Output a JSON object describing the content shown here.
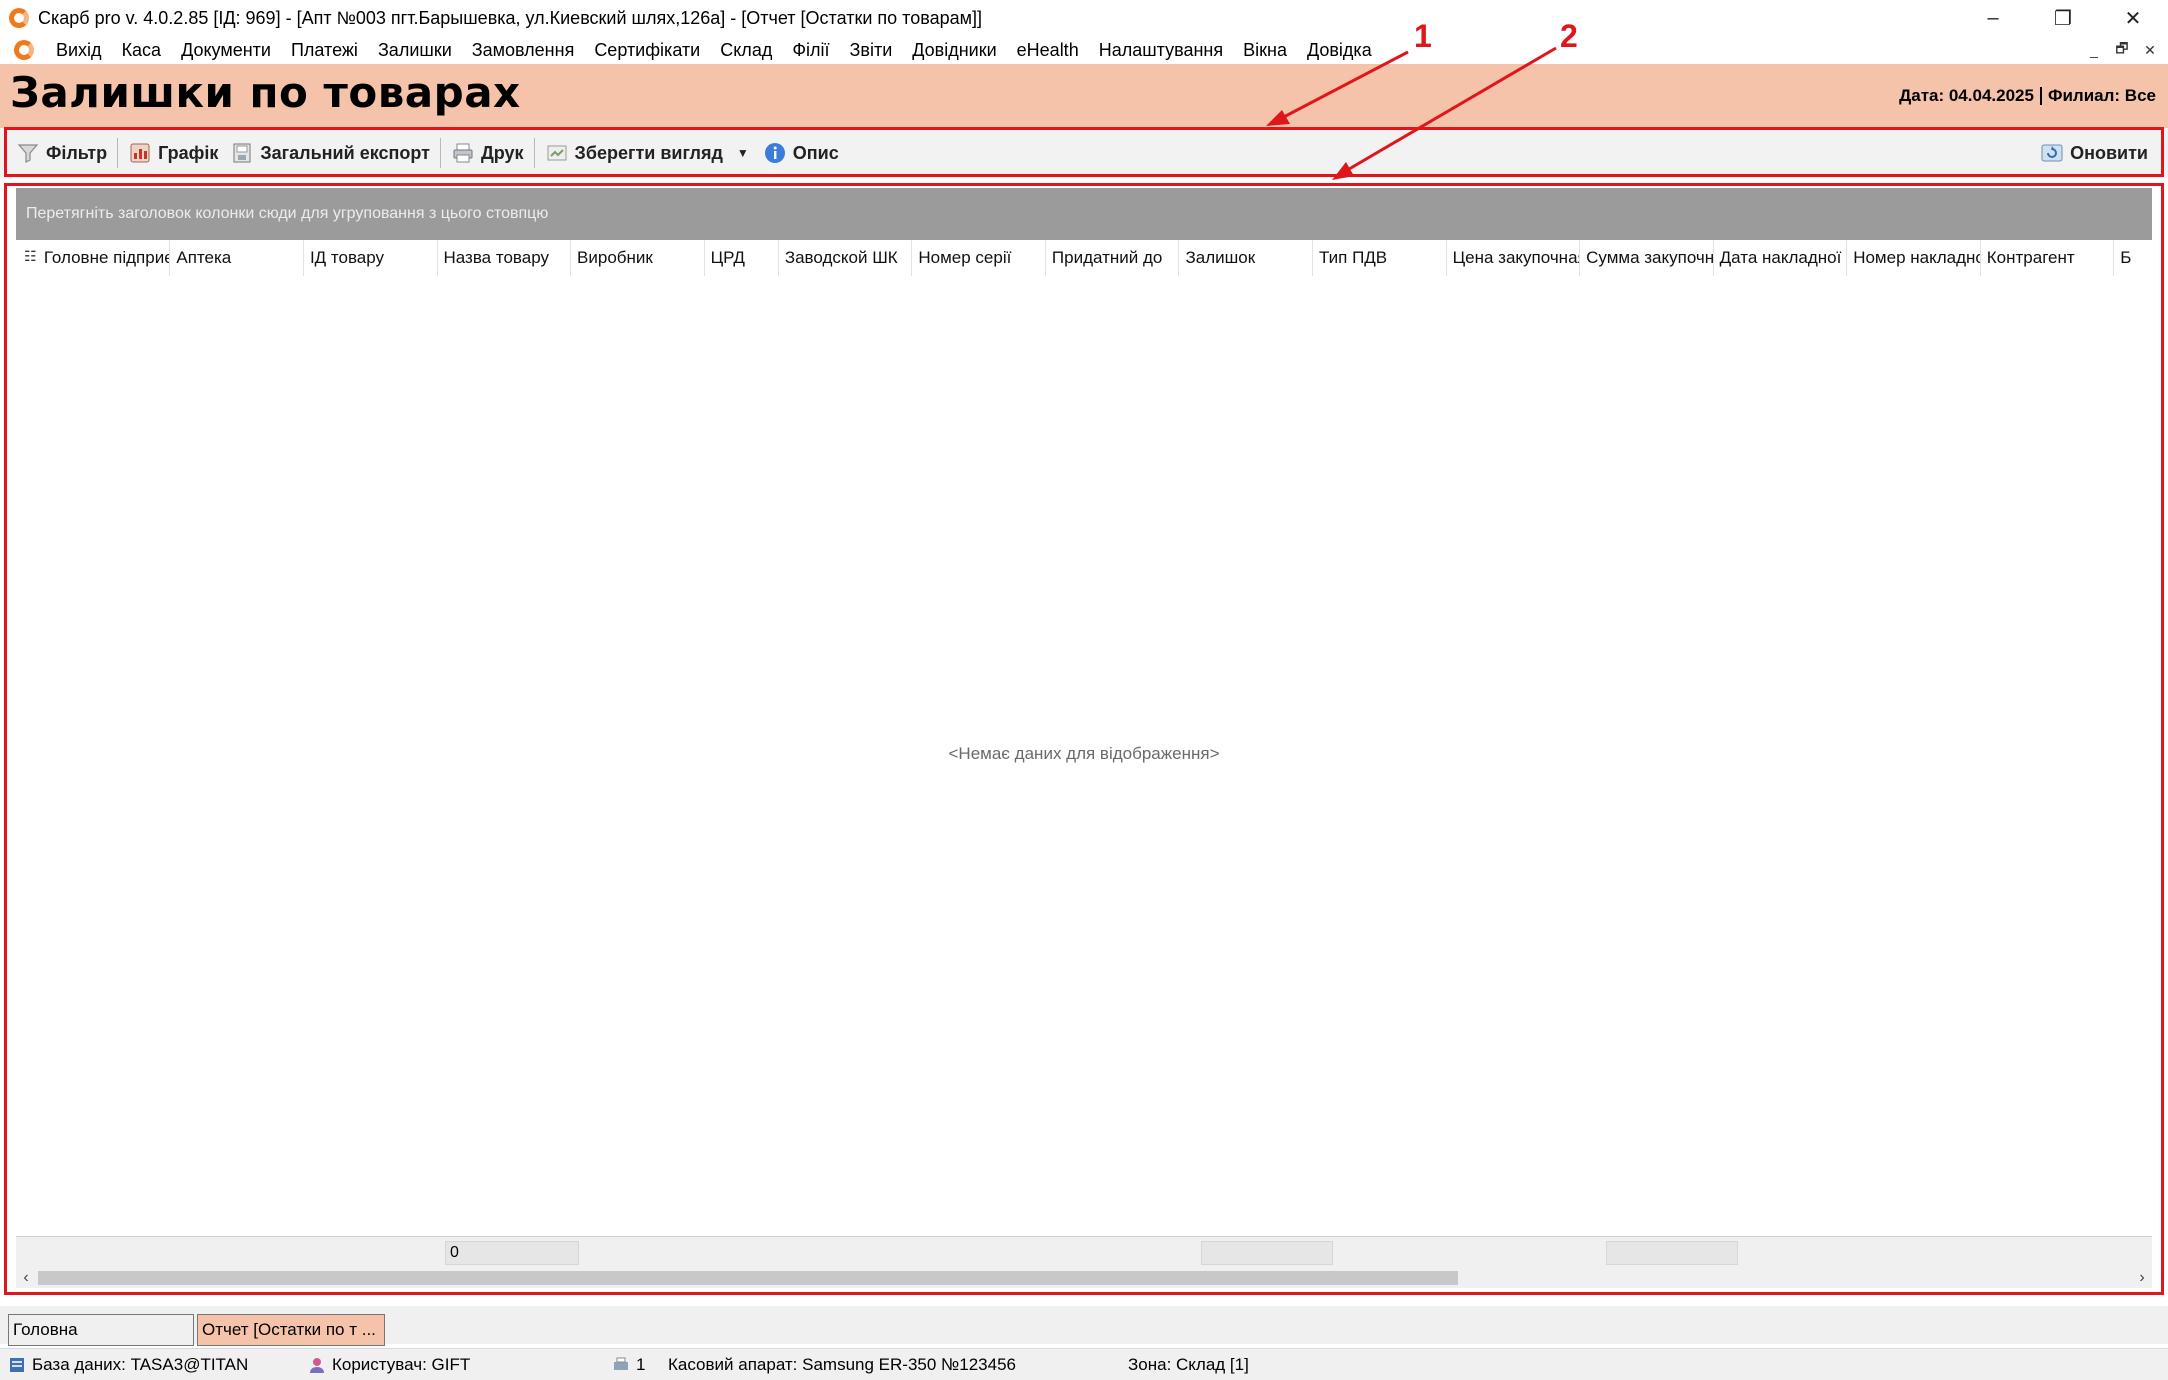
{
  "window": {
    "title": "Скарб pro v. 4.0.2.85 [ІД: 969] - [Апт №003 пгт.Барышевка, ул.Киевский шлях,126а] - [Отчет [Остатки по товарам]]",
    "controls": {
      "minimize": "–",
      "restore": "❐",
      "close": "✕"
    }
  },
  "menu": {
    "items": [
      "Вихід",
      "Каса",
      "Документи",
      "Платежі",
      "Залишки",
      "Замовлення",
      "Сертифікати",
      "Склад",
      "Філії",
      "Звіти",
      "Довідники",
      "eHealth",
      "Налаштування",
      "Вікна",
      "Довідка"
    ],
    "mdi": {
      "minimize": "_",
      "restore": "🗗",
      "close": "✕"
    }
  },
  "header": {
    "title": "Залишки по товарах",
    "date_label": "Дата: 04.04.2025",
    "branch_label": "Филиал: Все",
    "background": "#f5c3a9"
  },
  "toolbar": {
    "filter": "Фільтр",
    "chart": "Графік",
    "export": "Загальний експорт",
    "print": "Друк",
    "save_view": "Зберегти вигляд",
    "description": "Опис",
    "refresh": "Оновити"
  },
  "annotations": {
    "label1": "1",
    "label2": "2",
    "color": "#e0161b"
  },
  "grid": {
    "group_hint": "Перетягніть заголовок колонки сюди для угруповання з цього стовпцю",
    "columns": [
      "Головне підприємство",
      "Аптека",
      "ІД товару",
      "Назва товару",
      "Виробник",
      "ЦРД",
      "Заводской ШК",
      "Номер серії",
      "Придатний до",
      "Залишок",
      "Тип ПДВ",
      "Цена закупочная",
      "Сумма закупочная",
      "Дата накладної",
      "Номер накладної",
      "Контрагент",
      "Б"
    ],
    "empty_message": "<Немає даних для відображення>",
    "footer": {
      "count": "0"
    }
  },
  "tabs": [
    {
      "label": "Головна",
      "active": false
    },
    {
      "label": "Отчет [Остатки по т ...",
      "active": true
    }
  ],
  "status": {
    "database": "База даних: TASA3@TITAN",
    "user": "Користувач: GIFT",
    "printer_count": "1",
    "cash_register": "Касовий апарат: Samsung ER-350 №123456",
    "zone": "Зона: Склад [1]"
  }
}
